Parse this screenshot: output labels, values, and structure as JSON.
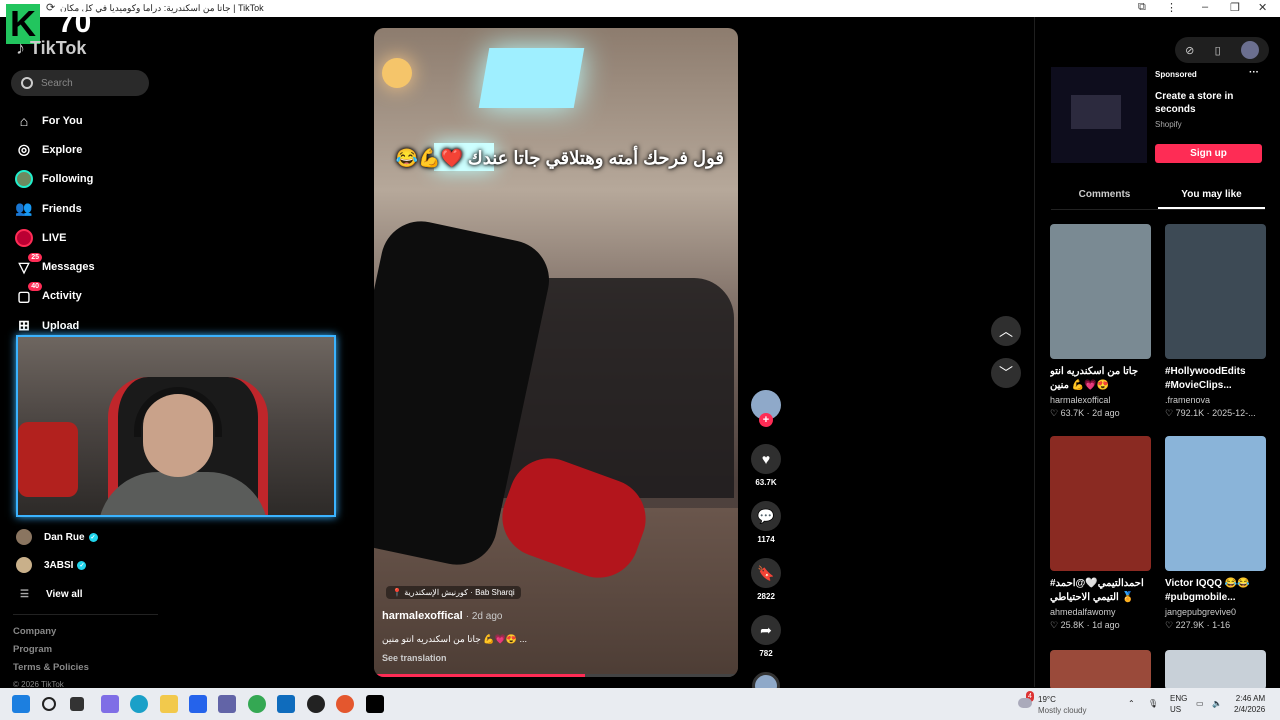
{
  "window": {
    "title": "جاتا من اسكندرية: دراما وكوميديا في كل مكان | TikTok"
  },
  "overlay": {
    "k_letter": "K",
    "number": "70"
  },
  "app": {
    "logo": "TikTok"
  },
  "search": {
    "placeholder": "Search"
  },
  "nav": [
    {
      "label": "For You",
      "icon": "home-icon"
    },
    {
      "label": "Explore",
      "icon": "compass-icon"
    },
    {
      "label": "Following",
      "icon": "following-avatar-icon"
    },
    {
      "label": "Friends",
      "icon": "friends-icon"
    },
    {
      "label": "LIVE",
      "icon": "live-icon"
    },
    {
      "label": "Messages",
      "icon": "messages-icon",
      "badge": "25"
    },
    {
      "label": "Activity",
      "icon": "activity-icon",
      "badge": "40"
    },
    {
      "label": "Upload",
      "icon": "upload-icon"
    }
  ],
  "following_accounts": [
    {
      "name": "Dan Rue",
      "verified": true
    },
    {
      "name": "3ABSI",
      "verified": true
    }
  ],
  "view_all": "View all",
  "footer": {
    "company": "Company",
    "program": "Program",
    "terms": "Terms & Policies",
    "copyright": "© 2026 TikTok"
  },
  "video": {
    "overlay_text": "قول فرحك أمته وهتلاقي جاتا عندك ❤️💪😂",
    "location": "كورنيش الإسكندرية · Bab Sharqi",
    "author": "harmalexoffical",
    "when": "· 2d ago",
    "description": "جاتا من اسكندريه انتو منين 💪💗😍 ...",
    "see_translation": "See translation",
    "progress": 0.58,
    "likes": "63.7K",
    "comments": "1174",
    "saves": "2822",
    "shares": "782"
  },
  "ad": {
    "sponsored": "Sponsored",
    "title": "Create a store in seconds",
    "brand": "Shopify",
    "cta": "Sign up"
  },
  "tabs": {
    "comments": "Comments",
    "you_may_like": "You may like"
  },
  "recommendations": [
    {
      "caption": "جاتا من اسكندريه انتو منين 💪💗😍",
      "user": "harmalexoffical",
      "likes": "63.7K",
      "date": "2d ago",
      "color": "#7a8a93"
    },
    {
      "caption": "#HollywoodEdits #MovieClips...",
      "user": ".framenova",
      "likes": "792.1K",
      "date": "2025-12-...",
      "color": "#3d4a55"
    },
    {
      "caption": "احمدالتيمي🤍@احمد# التيمي الاحتياطي 🏅",
      "user": "ahmedalfawomy",
      "likes": "25.8K",
      "date": "1d ago",
      "color": "#8a2a22"
    },
    {
      "caption": "Victor IQQQ 😂😂 #pubgmobile...",
      "user": "jangepubgrevive0",
      "likes": "227.9K",
      "date": "1-16",
      "color": "#8ab4d9"
    }
  ],
  "taskbar": {
    "weather_temp": "19°C",
    "weather_desc": "Mostly cloudy",
    "weather_badge": "4",
    "lang1": "ENG",
    "lang2": "US",
    "time": "2:46 AM",
    "date": "2/4/2026"
  }
}
